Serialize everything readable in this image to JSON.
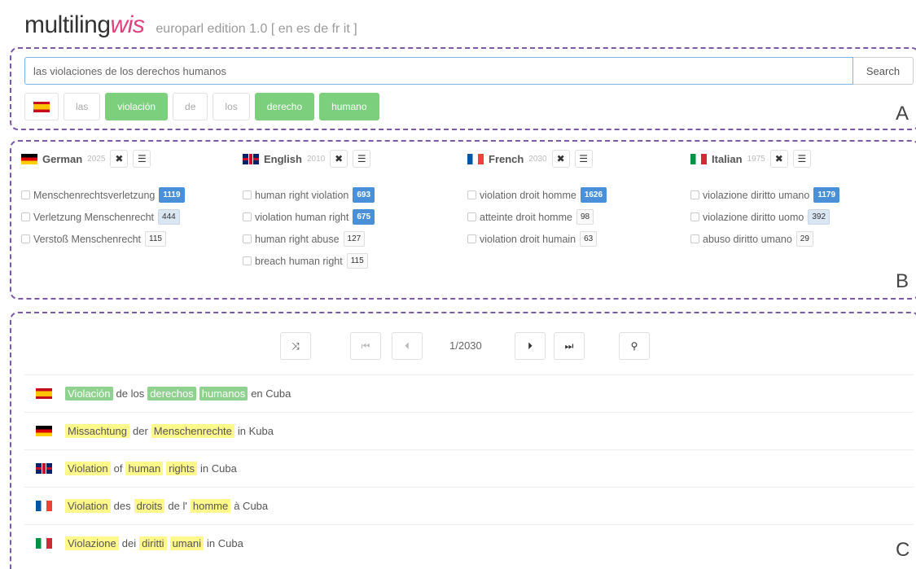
{
  "header": {
    "brand_main": "multiling",
    "brand_accent": "wis",
    "edition": "europarl edition 1.0",
    "langs": "[ en es de fr it ]"
  },
  "search": {
    "value": "las violaciones de los derechos humanos",
    "button": "Search"
  },
  "tokens": [
    {
      "text": "las",
      "hit": false
    },
    {
      "text": "violación",
      "hit": true
    },
    {
      "text": "de",
      "hit": false
    },
    {
      "text": "los",
      "hit": false
    },
    {
      "text": "derecho",
      "hit": true
    },
    {
      "text": "humano",
      "hit": true
    }
  ],
  "section_labels": {
    "a": "A",
    "b": "B",
    "c": "C"
  },
  "languages": [
    {
      "name": "German",
      "count": "2025",
      "flag": "flag-de",
      "terms": [
        {
          "text": "Menschenrechtsverletzung",
          "n": "1119",
          "style": "hi"
        },
        {
          "text": "Verletzung Menschenrecht",
          "n": "444",
          "style": "mid"
        },
        {
          "text": "Verstoß Menschenrecht",
          "n": "115",
          "style": "lo"
        }
      ]
    },
    {
      "name": "English",
      "count": "2010",
      "flag": "flag-gb",
      "terms": [
        {
          "text": "human right violation",
          "n": "693",
          "style": "hi"
        },
        {
          "text": "violation human right",
          "n": "675",
          "style": "hi"
        },
        {
          "text": "human right abuse",
          "n": "127",
          "style": "lo"
        },
        {
          "text": "breach human right",
          "n": "115",
          "style": "lo"
        }
      ]
    },
    {
      "name": "French",
      "count": "2030",
      "flag": "flag-fr",
      "terms": [
        {
          "text": "violation droit homme",
          "n": "1626",
          "style": "hi"
        },
        {
          "text": "atteinte droit homme",
          "n": "98",
          "style": "lo"
        },
        {
          "text": "violation droit humain",
          "n": "63",
          "style": "lo"
        }
      ]
    },
    {
      "name": "Italian",
      "count": "1975",
      "flag": "flag-it",
      "terms": [
        {
          "text": "violazione diritto umano",
          "n": "1179",
          "style": "hi"
        },
        {
          "text": "violazione diritto uomo",
          "n": "392",
          "style": "mid"
        },
        {
          "text": "abuso diritto umano",
          "n": "29",
          "style": "lo"
        }
      ]
    }
  ],
  "navigation": {
    "shuffle_icon": "⤨",
    "first_icon": "⏮",
    "prev_icon": "⏴",
    "page": "1/2030",
    "next_icon": "⏵",
    "last_icon": "⏭",
    "search_icon": "⚲"
  },
  "sentences": [
    {
      "flag": "flag-es",
      "words": [
        {
          "t": "Violación",
          "h": "g"
        },
        {
          "t": "de los",
          "h": ""
        },
        {
          "t": "derechos",
          "h": "g"
        },
        {
          "t": "humanos",
          "h": "g"
        },
        {
          "t": "en Cuba",
          "h": ""
        }
      ]
    },
    {
      "flag": "flag-de",
      "words": [
        {
          "t": "Missachtung",
          "h": "y"
        },
        {
          "t": "der",
          "h": ""
        },
        {
          "t": "Menschenrechte",
          "h": "y"
        },
        {
          "t": "in Kuba",
          "h": ""
        }
      ]
    },
    {
      "flag": "flag-gb",
      "words": [
        {
          "t": "Violation",
          "h": "y"
        },
        {
          "t": "of",
          "h": ""
        },
        {
          "t": "human",
          "h": "y"
        },
        {
          "t": "rights",
          "h": "y"
        },
        {
          "t": "in Cuba",
          "h": ""
        }
      ]
    },
    {
      "flag": "flag-fr",
      "words": [
        {
          "t": "Violation",
          "h": "y"
        },
        {
          "t": "des",
          "h": ""
        },
        {
          "t": "droits",
          "h": "y"
        },
        {
          "t": "de l'",
          "h": ""
        },
        {
          "t": "homme",
          "h": "y"
        },
        {
          "t": "à Cuba",
          "h": ""
        }
      ]
    },
    {
      "flag": "flag-it",
      "words": [
        {
          "t": "Violazione",
          "h": "y"
        },
        {
          "t": "dei",
          "h": ""
        },
        {
          "t": "diritti",
          "h": "y"
        },
        {
          "t": "umani",
          "h": "y"
        },
        {
          "t": "in Cuba",
          "h": ""
        }
      ]
    }
  ],
  "colors": {
    "accent": "#e2407a",
    "hit_green": "#7ccf7c",
    "badge_blue": "#4a90d9",
    "highlight_yellow": "#fff88a",
    "section_border": "#7c5aa6"
  }
}
